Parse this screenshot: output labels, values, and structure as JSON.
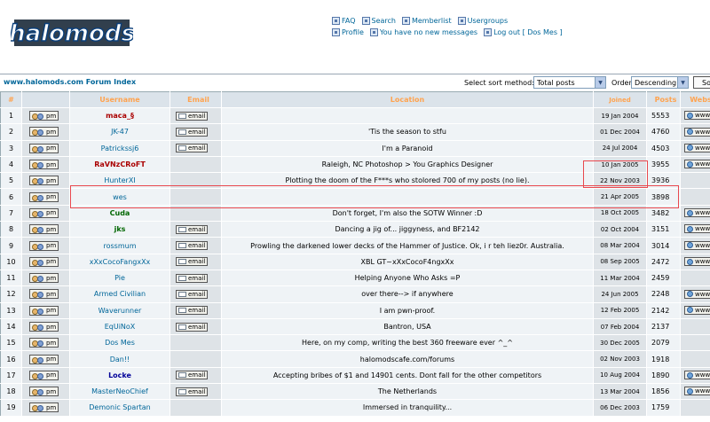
{
  "header": {
    "logo_text": "halomods",
    "nav_row1": [
      {
        "label": "FAQ",
        "icon": "faq-icon"
      },
      {
        "label": "Search",
        "icon": "search-icon"
      },
      {
        "label": "Memberlist",
        "icon": "memberlist-icon"
      },
      {
        "label": "Usergroups",
        "icon": "usergroups-icon"
      }
    ],
    "nav_row2": [
      {
        "label": "Profile",
        "icon": "profile-icon"
      },
      {
        "label": "You have no new messages",
        "icon": "messages-icon"
      },
      {
        "label": "Log out [ Dos Mes ]",
        "icon": "logout-icon"
      }
    ]
  },
  "topbar": {
    "forum_index": "www.halomods.com Forum Index",
    "sort_label": "Select sort method:",
    "sort_value": "Total posts",
    "order_label": "Order",
    "order_value": "Descending",
    "sort_button": "Sort"
  },
  "columns": [
    "#",
    "",
    "Username",
    "Email",
    "Location",
    "Joined",
    "Posts",
    "Website"
  ],
  "buttons": {
    "pm": "pm",
    "email": "email",
    "www": "www"
  },
  "colors": {
    "header_text": "#ffa34f",
    "link": "#006699",
    "admin": "#aa0000",
    "mod_green": "#006600",
    "mod_blue": "#000099"
  },
  "members": [
    {
      "num": "1",
      "username": "maca_§",
      "color": "#aa0000",
      "bold": true,
      "email": true,
      "location": "",
      "joined": "19 Jan 2004",
      "posts": "5553",
      "www": true
    },
    {
      "num": "2",
      "username": "JK-47",
      "color": "#006699",
      "bold": false,
      "email": true,
      "location": "'Tis the season to stfu",
      "joined": "01 Dec 2004",
      "posts": "4760",
      "www": true
    },
    {
      "num": "3",
      "username": "Patrickssj6",
      "color": "#006699",
      "bold": false,
      "email": true,
      "location": "I'm a Paranoid",
      "joined": "24 Jul 2004",
      "posts": "4503",
      "www": true
    },
    {
      "num": "4",
      "username": "RaVNzCRoFT",
      "color": "#aa0000",
      "bold": true,
      "email": false,
      "location": "Raleigh, NC Photoshop > You Graphics Designer",
      "joined": "10 Jan 2005",
      "posts": "3955",
      "www": true
    },
    {
      "num": "5",
      "username": "HunterXI",
      "color": "#006699",
      "bold": false,
      "email": false,
      "location": "Plotting the doom of the F***s who stolored 700 of my posts (no lie).",
      "joined": "22 Nov 2003",
      "posts": "3936",
      "www": false
    },
    {
      "num": "6",
      "username": "wes",
      "color": "#006699",
      "bold": false,
      "email": false,
      "location": "",
      "joined": "21 Apr 2005",
      "posts": "3898",
      "www": false
    },
    {
      "num": "7",
      "username": "Cuda",
      "color": "#006600",
      "bold": true,
      "email": false,
      "location": "Don't forget, I'm also the SOTW Winner :D",
      "joined": "18 Oct 2005",
      "posts": "3482",
      "www": true
    },
    {
      "num": "8",
      "username": "jks",
      "color": "#006600",
      "bold": true,
      "email": true,
      "location": "Dancing a jig of... jiggyness, and BF2142",
      "joined": "02 Oct 2004",
      "posts": "3151",
      "www": true
    },
    {
      "num": "9",
      "username": "rossmum",
      "color": "#006699",
      "bold": false,
      "email": true,
      "location": "Prowling the darkened lower decks of the Hammer of Justice. Ok, i r teh liez0r. Australia.",
      "joined": "08 Mar 2004",
      "posts": "3014",
      "www": true
    },
    {
      "num": "10",
      "username": "xXxCocoFangxXx",
      "color": "#006699",
      "bold": false,
      "email": true,
      "location": "XBL GT~xXxCocoF4ngxXx",
      "joined": "08 Sep 2005",
      "posts": "2472",
      "www": true
    },
    {
      "num": "11",
      "username": "Pie",
      "color": "#006699",
      "bold": false,
      "email": true,
      "location": "Helping Anyone Who Asks =P",
      "joined": "11 Mar 2004",
      "posts": "2459",
      "www": false
    },
    {
      "num": "12",
      "username": "Armed Civilian",
      "color": "#006699",
      "bold": false,
      "email": true,
      "location": "over there--> if anywhere",
      "joined": "24 Jun 2005",
      "posts": "2248",
      "www": true
    },
    {
      "num": "13",
      "username": "Waverunner",
      "color": "#006699",
      "bold": false,
      "email": true,
      "location": "I am pwn-proof.",
      "joined": "12 Feb 2005",
      "posts": "2142",
      "www": true
    },
    {
      "num": "14",
      "username": "EqUiNoX",
      "color": "#006699",
      "bold": false,
      "email": true,
      "location": "Bantron, USA",
      "joined": "07 Feb 2004",
      "posts": "2137",
      "www": false
    },
    {
      "num": "15",
      "username": "Dos Mes",
      "color": "#006699",
      "bold": false,
      "email": false,
      "location": "Here, on my comp, writing the best 360 freeware ever ^_^",
      "joined": "30 Dec 2005",
      "posts": "2079",
      "www": false
    },
    {
      "num": "16",
      "username": "Dan!!",
      "color": "#006699",
      "bold": false,
      "email": false,
      "location": "halomodscafe.com/forums",
      "joined": "02 Nov 2003",
      "posts": "1918",
      "www": false
    },
    {
      "num": "17",
      "username": "Locke",
      "color": "#000099",
      "bold": true,
      "email": true,
      "location": "Accepting bribes of $1 and 14901 cents. Dont fall for the other competitors",
      "joined": "10 Aug 2004",
      "posts": "1890",
      "www": true
    },
    {
      "num": "18",
      "username": "MasterNeoChief",
      "color": "#006699",
      "bold": false,
      "email": true,
      "location": "The Netherlands",
      "joined": "13 Mar 2004",
      "posts": "1856",
      "www": true
    },
    {
      "num": "19",
      "username": "Demonic Spartan",
      "color": "#006699",
      "bold": false,
      "email": false,
      "location": "Immersed in tranquility...",
      "joined": "06 Dec 2003",
      "posts": "1759",
      "www": false
    }
  ]
}
